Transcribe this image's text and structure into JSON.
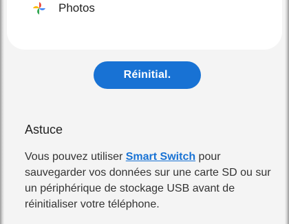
{
  "app_list": {
    "item": {
      "icon": "google-photos-pinwheel-icon",
      "label": "Photos"
    }
  },
  "reset_button": {
    "label": "Réinitial.",
    "color": "#1872d4"
  },
  "tip": {
    "title": "Astuce",
    "text_before": "Vous pouvez utiliser ",
    "link_label": "Smart Switch",
    "text_after": " pour sauvegarder vos données sur une carte SD ou sur un périphérique de stockage USB avant de réinitialiser votre téléphone."
  }
}
